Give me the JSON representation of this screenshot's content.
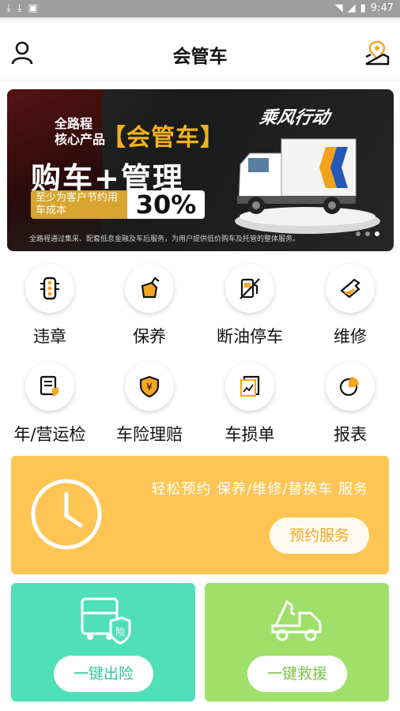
{
  "status_bar": {
    "time": "9:47"
  },
  "app_bar": {
    "title": "会管车"
  },
  "banner": {
    "line1": "全路程",
    "line2": "核心产品",
    "brand": "【会管车】",
    "headline": "购车+管理",
    "pill_left": "至少为客户节约用车成本",
    "pill_right": "30%",
    "footer": "全路程通过集采、配套低息金融及车后服务，为用户提供低价购车及托管的整体服务。",
    "slogan": "乘风行动",
    "page_count": 3,
    "active_page": 2
  },
  "quick_menu": [
    {
      "label": "违章",
      "icon": "traffic-light-icon"
    },
    {
      "label": "保养",
      "icon": "oil-can-icon"
    },
    {
      "label": "断油停车",
      "icon": "fuel-stop-icon"
    },
    {
      "label": "维修",
      "icon": "wrench-icon"
    },
    {
      "label": "年/营运检",
      "icon": "inspection-doc-icon"
    },
    {
      "label": "车险理赔",
      "icon": "insurance-shield-icon"
    },
    {
      "label": "车损单",
      "icon": "damage-report-icon"
    },
    {
      "label": "报表",
      "icon": "pie-chart-icon"
    }
  ],
  "booking": {
    "text": "轻松预约 保养/维修/替换车 服务",
    "button": "预约服务"
  },
  "cards": [
    {
      "button": "一键出险",
      "icon": "truck-insurance-icon"
    },
    {
      "button": "一键救援",
      "icon": "tow-truck-icon"
    }
  ],
  "colors": {
    "accent_orange": "#f5a623",
    "booking_bg": "#ffc554",
    "card_green": "#4fe0b8",
    "card_lime": "#9fe06a"
  }
}
